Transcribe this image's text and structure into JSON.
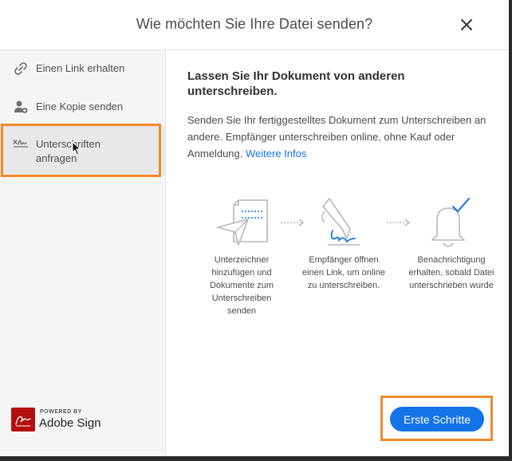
{
  "dialog": {
    "title": "Wie möchten Sie Ihre Datei senden?",
    "close_icon": "close-icon"
  },
  "sidebar": {
    "items": [
      {
        "label": "Einen Link erhalten",
        "icon": "link-icon"
      },
      {
        "label": "Eine Kopie senden",
        "icon": "person-add-icon"
      },
      {
        "label": "Unterschriften anfragen",
        "icon": "signature-icon",
        "active": true
      }
    ],
    "powered_by": {
      "small": "POWERED BY",
      "brand": "Adobe Sign"
    }
  },
  "main": {
    "heading": "Lassen Sie Ihr Dokument von anderen unterschreiben.",
    "description": "Senden Sie Ihr fertiggestelltes Dokument zum Unterschreiben an andere. Empfänger unterschreiben online, ohne Kauf oder Anmeldung.",
    "link_label": "Weitere Infos",
    "steps": [
      {
        "text": "Unterzeichner hinzufügen und Dokumente zum Unterschreiben senden",
        "icon": "send-document-icon"
      },
      {
        "text": "Empfänger öffnen einen Link, um online zu unterschreiben.",
        "icon": "pen-signature-icon"
      },
      {
        "text": "Benachrichtigung erhalten, sobald Datei unterschrieben wurde",
        "icon": "bell-check-icon"
      }
    ],
    "cta_label": "Erste Schritte"
  },
  "colors": {
    "accent": "#1473e6",
    "highlight": "#f08a2c",
    "brand_red": "#b40f0f"
  }
}
